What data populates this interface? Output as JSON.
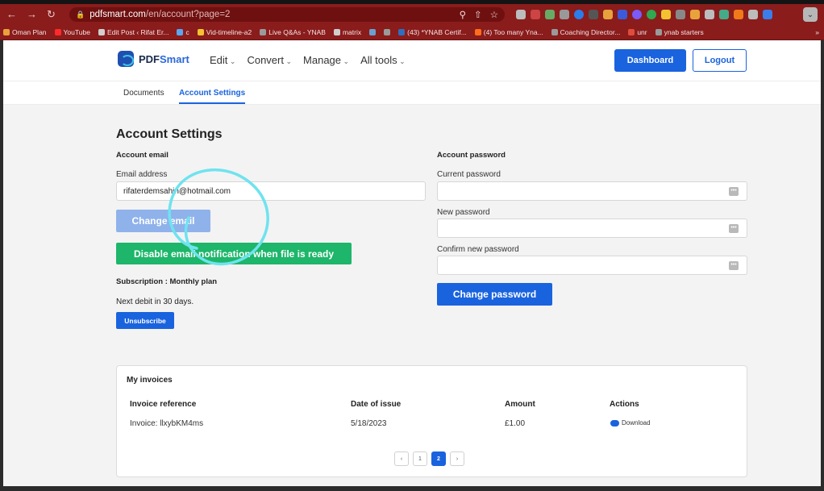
{
  "browser": {
    "url_host": "pdfsmart.com",
    "url_path": "/en/account?page=2",
    "bookmarks": [
      {
        "label": "Oman Plan",
        "color": "#e8a23c"
      },
      {
        "label": "YouTube",
        "color": "#ff2b2b"
      },
      {
        "label": "Edit Post ‹ Rifat Er...",
        "color": "#cfcfcf"
      },
      {
        "label": "c",
        "color": "#5aa6f0"
      },
      {
        "label": "Vid-timeline-a2",
        "color": "#f2c230"
      },
      {
        "label": "Live Q&As - YNAB",
        "color": "#9a9a9a"
      },
      {
        "label": "matrix",
        "color": "#cfcfcf"
      },
      {
        "label": "",
        "color": "#6aa0d0"
      },
      {
        "label": "",
        "color": "#9a9a9a"
      },
      {
        "label": "(43) *YNAB Certif...",
        "color": "#2d6fc2"
      },
      {
        "label": "(4) Too many Yna...",
        "color": "#ff6d1a"
      },
      {
        "label": "Coaching Director...",
        "color": "#9a9a9a"
      },
      {
        "label": "unr",
        "color": "#e04c3c"
      },
      {
        "label": "ynab starters",
        "color": "#9a9a9a"
      }
    ],
    "bookmarks_overflow": "»"
  },
  "header": {
    "logo_prefix": "PDF",
    "logo_suffix": "Smart",
    "nav": [
      "Edit",
      "Convert",
      "Manage",
      "All tools"
    ],
    "dashboard_label": "Dashboard",
    "logout_label": "Logout"
  },
  "subnav": {
    "documents": "Documents",
    "account_settings": "Account Settings"
  },
  "account": {
    "title": "Account Settings",
    "email_section": "Account email",
    "email_label": "Email address",
    "email_value": "rifaterdemsahin@hotmail.com",
    "change_email": "Change email",
    "disable_notification": "Disable email notification when file is ready",
    "subscription": "Subscription : Monthly plan",
    "next_debit": "Next debit in 30 days.",
    "unsubscribe": "Unsubscribe",
    "password_section": "Account password",
    "current_password": "Current password",
    "new_password": "New password",
    "confirm_password": "Confirm new password",
    "change_password": "Change password",
    "pw_dots_icon": "•••"
  },
  "invoices": {
    "title": "My invoices",
    "headers": [
      "Invoice reference",
      "Date of issue",
      "Amount",
      "Actions"
    ],
    "rows": [
      {
        "reference": "Invoice: llxybKM4ms",
        "date": "5/18/2023",
        "amount": "£1.00",
        "action": "Download"
      }
    ],
    "pages": [
      "1",
      "2"
    ],
    "current_page": "2",
    "prev": "‹",
    "next": "›"
  },
  "colors": {
    "primary": "#1a63de",
    "primary_disabled": "#8fb2eb",
    "success": "#1db66a",
    "chrome": "#8a1c1c",
    "annotation": "#6fe3ef"
  }
}
